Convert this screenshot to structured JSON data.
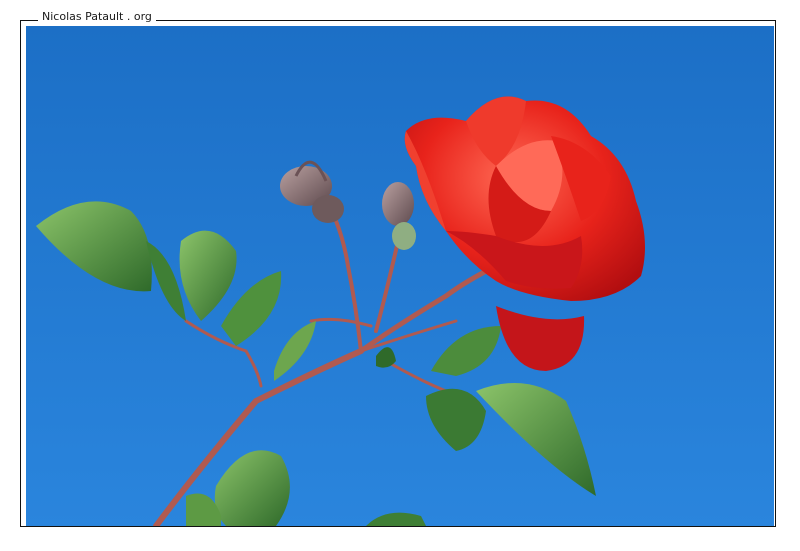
{
  "credit": "Nicolas Patault . org",
  "photo": {
    "subject_icon": "red-rose-with-buds-photo",
    "colors": {
      "sky": "#1f78cf",
      "sky_light": "#2d8ae0",
      "petal": "#e01f1a",
      "petal_light": "#ff5a4a",
      "petal_dark": "#b00f12",
      "leaf": "#4d8a3a",
      "leaf_light": "#7cb55a",
      "stem": "#b35a50"
    }
  }
}
